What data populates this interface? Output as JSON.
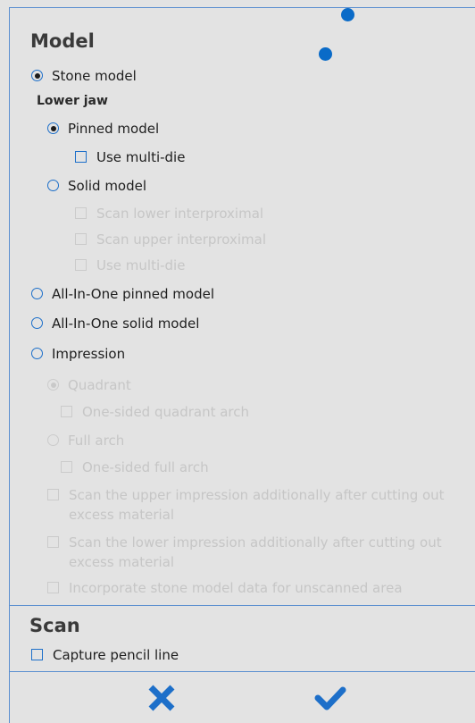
{
  "model_section": {
    "title": "Model",
    "stone_model": "Stone model",
    "lower_jaw": "Lower jaw",
    "pinned_model": "Pinned model",
    "use_multi_die": "Use multi-die",
    "solid_model": "Solid model",
    "scan_lower_interproximal": "Scan lower interproximal",
    "scan_upper_interproximal": "Scan upper interproximal",
    "use_multi_die_solid": "Use multi-die",
    "all_in_one_pinned": "All-In-One pinned model",
    "all_in_one_solid": "All-In-One solid model",
    "impression": "Impression",
    "quadrant": "Quadrant",
    "one_sided_quadrant_arch": "One-sided quadrant arch",
    "full_arch": "Full arch",
    "one_sided_full_arch": "One-sided full arch",
    "scan_upper_impression": "Scan the upper impression additionally after cutting out excess material",
    "scan_lower_impression": "Scan the lower impression additionally after cutting out excess material",
    "incorporate_stone_model": "Incorporate stone model data for unscanned area"
  },
  "scan_section": {
    "title": "Scan",
    "capture_pencil_line": "Capture pencil line"
  },
  "footer": {
    "cancel_icon": "close-icon",
    "confirm_icon": "checkmark-icon"
  },
  "colors": {
    "accent": "#1d6fc9",
    "frame": "#5b8fd0",
    "background": "#e3e3e3",
    "disabled_text": "#c6c6c6",
    "handle_dot": "#0a6bc8"
  }
}
